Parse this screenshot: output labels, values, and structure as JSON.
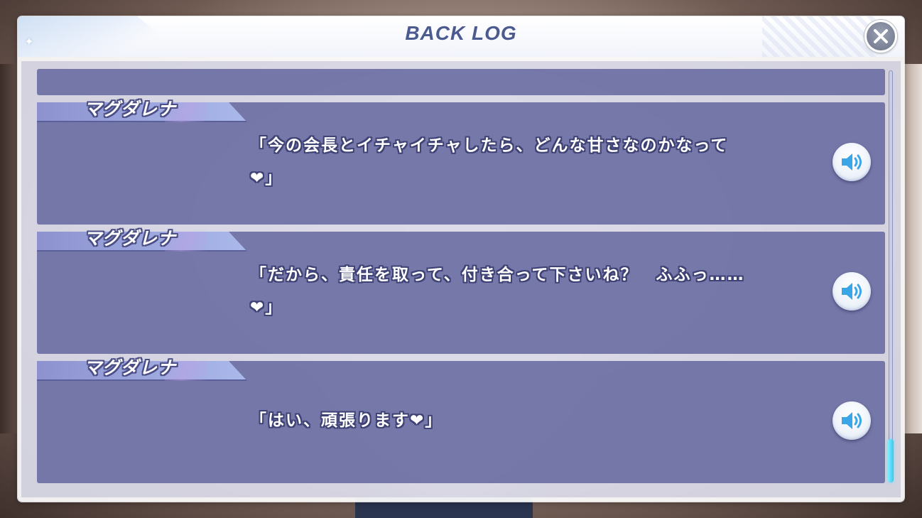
{
  "header": {
    "title": "BACK LOG"
  },
  "icons": {
    "close": "close-icon",
    "voice": "speaker-icon",
    "sparkle": "sparkle-icon"
  },
  "colors": {
    "entry_background": "#686aa0",
    "name_tab": "#9da8de",
    "title_text": "#4b5a8f",
    "scroll_thumb": "#38c7ef"
  },
  "entries": [
    {
      "speaker": "マグダレナ",
      "line1": "「今の会長とイチャイチャしたら、どんな甘さなのかなって",
      "line2": "❤」"
    },
    {
      "speaker": "マグダレナ",
      "line1": "「だから、責任を取って、付き合って下さいね？　ふふっ……",
      "line2": "❤」"
    },
    {
      "speaker": "マグダレナ",
      "line1": "「はい、頑張ります❤」"
    }
  ],
  "scroll": {
    "position_fraction": 0.98
  }
}
